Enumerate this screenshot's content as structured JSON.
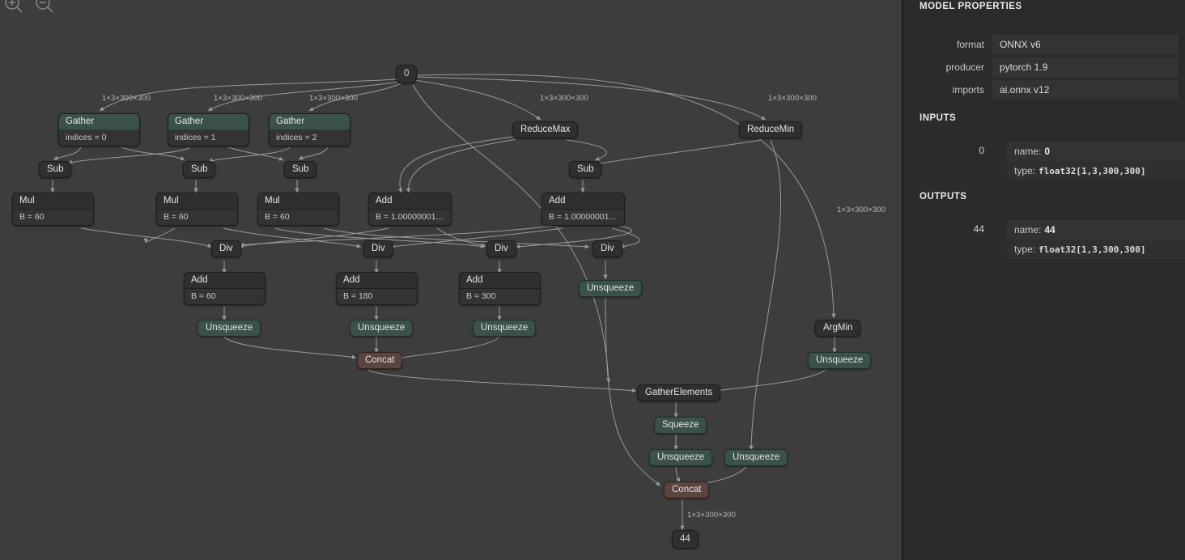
{
  "app": {
    "name": "netron-onnx-graph-viewer"
  },
  "toolbar": {
    "zoom_in_icon": "zoom-in-icon",
    "zoom_out_icon": "zoom-out-icon"
  },
  "sidebar": {
    "sections": {
      "model_properties": "MODEL PROPERTIES",
      "inputs": "INPUTS",
      "outputs": "OUTPUTS"
    },
    "properties": [
      {
        "label": "format",
        "value": "ONNX v6"
      },
      {
        "label": "producer",
        "value": "pytorch 1.9"
      },
      {
        "label": "imports",
        "value": "ai.onnx v12"
      }
    ],
    "inputs": [
      {
        "index": "0",
        "name_label": "name:",
        "name_value": "0",
        "type_label": "type:",
        "type_value": "float32[1,3,300,300]"
      }
    ],
    "outputs": [
      {
        "index": "44",
        "name_label": "name:",
        "name_value": "44",
        "type_label": "type:",
        "type_value": "float32[1,3,300,300]"
      }
    ]
  },
  "graph": {
    "colors": {
      "canvas_bg": "#3d3d3d",
      "sidebar_bg": "#2b2b2b",
      "node_dark": "#2f2f2f",
      "node_green": "#3a5248",
      "node_red": "#5b4440",
      "edge": "#9a9a9a",
      "text": "#e4e4e4"
    },
    "nodes": {
      "input_0": "0",
      "gather_0": "Gather",
      "gather_0_attr": "indices = 0",
      "gather_1": "Gather",
      "gather_1_attr": "indices = 1",
      "gather_2": "Gather",
      "gather_2_attr": "indices = 2",
      "reducemax": "ReduceMax",
      "reducemin": "ReduceMin",
      "sub_0": "Sub",
      "sub_1": "Sub",
      "sub_2": "Sub",
      "sub_3": "Sub",
      "mul_0": "Mul",
      "mul_0_attr": "B = 60",
      "mul_1": "Mul",
      "mul_1_attr": "B = 60",
      "mul_2": "Mul",
      "mul_2_attr": "B = 60",
      "add_eps_0": "Add",
      "add_eps_0_attr": "B = 1.00000001...",
      "add_eps_1": "Add",
      "add_eps_1_attr": "B = 1.00000001...",
      "div_0": "Div",
      "div_1": "Div",
      "div_2": "Div",
      "div_3": "Div",
      "add_60": "Add",
      "add_60_attr": "B = 60",
      "add_180": "Add",
      "add_180_attr": "B = 180",
      "add_300": "Add",
      "add_300_attr": "B = 300",
      "unsqueeze_0": "Unsqueeze",
      "unsqueeze_1": "Unsqueeze",
      "unsqueeze_2": "Unsqueeze",
      "unsqueeze_3": "Unsqueeze",
      "argmin": "ArgMin",
      "unsqueeze_argmin": "Unsqueeze",
      "concat_0": "Concat",
      "gatherelements": "GatherElements",
      "squeeze": "Squeeze",
      "unsqueeze_4": "Unsqueeze",
      "unsqueeze_5": "Unsqueeze",
      "concat_1": "Concat",
      "output_44": "44"
    },
    "edge_labels": {
      "e0": "1×3×300×300",
      "e1": "1×3×300×300",
      "e2": "1×3×300×300",
      "e3": "1×3×300×300",
      "e4": "1×3×300×300",
      "e5": "1×3×300×300",
      "e6": "1×3×300×300"
    }
  }
}
